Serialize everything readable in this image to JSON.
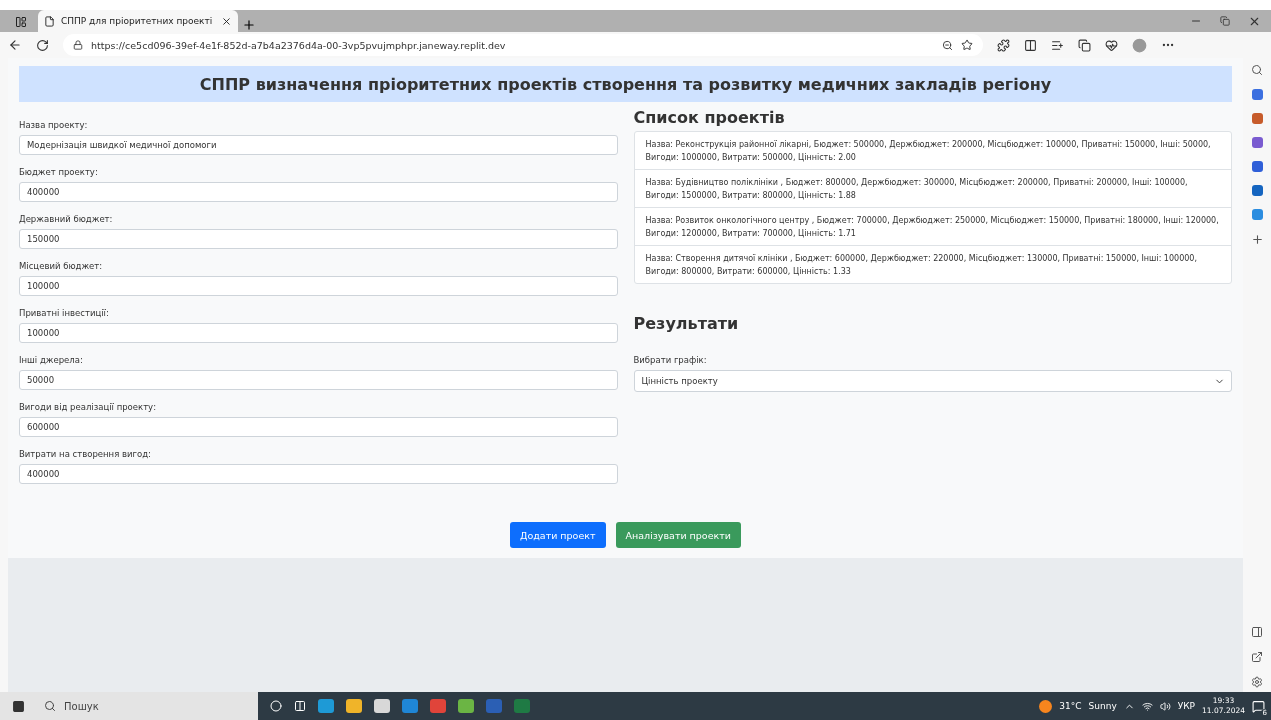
{
  "browser": {
    "tab_title": "СППР для пріоритетних проекті",
    "url": "https://ce5cd096-39ef-4e1f-852d-a7b4a2376d4a-00-3vp5pvujmphpr.janeway.replit.dev"
  },
  "page": {
    "title": "СППР визначення пріоритетних проектів створення та розвитку медичних закладів регіону",
    "fields": [
      {
        "label": "Назва проекту:",
        "value": "Модернізація швидкої медичної допомоги"
      },
      {
        "label": "Бюджет проекту:",
        "value": "400000"
      },
      {
        "label": "Державний бюджет:",
        "value": "150000"
      },
      {
        "label": "Місцевий бюджет:",
        "value": "100000"
      },
      {
        "label": "Приватні інвестиції:",
        "value": "100000"
      },
      {
        "label": "Інші джерела:",
        "value": "50000"
      },
      {
        "label": "Вигоди від реалізації проекту:",
        "value": "600000"
      },
      {
        "label": "Витрати на створення вигод:",
        "value": "400000"
      }
    ],
    "projects_heading": "Список проектів",
    "projects": [
      "Назва: Реконструкція районної лікарні, Бюджет: 500000, Держбюджет: 200000, Місцбюджет: 100000, Приватні: 150000, Інші: 50000, Вигоди: 1000000, Витрати: 500000, Цінність: 2.00",
      "Назва: Будівництво поліклініки , Бюджет: 800000, Держбюджет: 300000, Місцбюджет: 200000, Приватні: 200000, Інші: 100000, Вигоди: 1500000, Витрати: 800000, Цінність: 1.88",
      "Назва: Розвиток онкологічного центру , Бюджет: 700000, Держбюджет: 250000, Місцбюджет: 150000, Приватні: 180000, Інші: 120000, Вигоди: 1200000, Витрати: 700000, Цінність: 1.71",
      "Назва: Створення дитячої клініки , Бюджет: 600000, Держбюджет: 220000, Місцбюджет: 130000, Приватні: 150000, Інші: 100000, Вигоди: 800000, Витрати: 600000, Цінність: 1.33"
    ],
    "results_heading": "Результати",
    "chart_select": {
      "label": "Вибрати графік:",
      "value": "Цінність проекту"
    },
    "buttons": [
      {
        "label": "Додати проект",
        "kind": "primary"
      },
      {
        "label": "Аналізувати проекти",
        "kind": "success"
      }
    ]
  },
  "taskbar": {
    "search_placeholder": "Пошук",
    "temperature": "31°C",
    "weather": "Sunny",
    "language": "УКР",
    "time": "19:33",
    "date": "11.07.2024",
    "notifications": "6"
  }
}
